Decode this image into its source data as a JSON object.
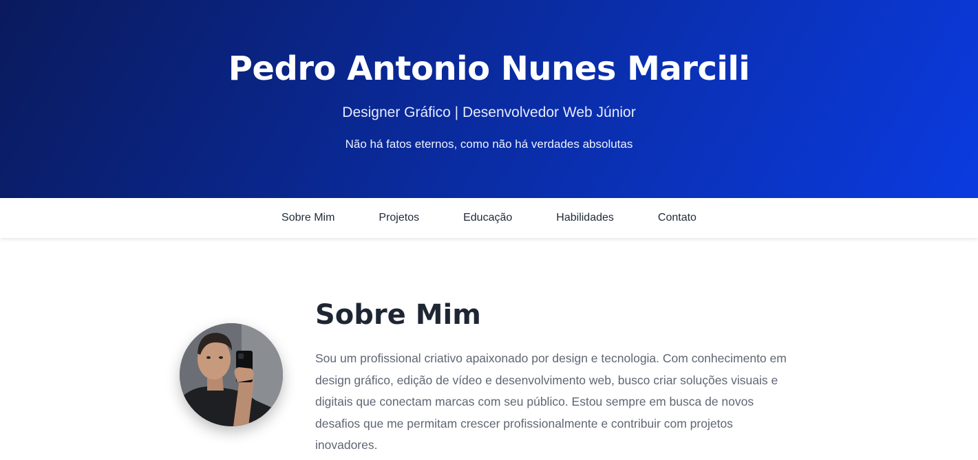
{
  "hero": {
    "name": "Pedro Antonio Nunes Marcili",
    "subtitle": "Designer Gráfico | Desenvolvedor Web Júnior",
    "quote": "Não há fatos eternos, como não há verdades absolutas"
  },
  "nav": {
    "items": [
      {
        "label": "Sobre Mim"
      },
      {
        "label": "Projetos"
      },
      {
        "label": "Educação"
      },
      {
        "label": "Habilidades"
      },
      {
        "label": "Contato"
      }
    ]
  },
  "about": {
    "title": "Sobre Mim",
    "text": "Sou um profissional criativo apaixonado por design e tecnologia. Com conhecimento em design gráfico, edição de vídeo e desenvolvimento web, busco criar soluções visuais e digitais que conectam marcas com seu público. Estou sempre em busca de novos desafios que me permitam crescer profissionalmente e contribuir com projetos inovadores."
  },
  "colors": {
    "hero_gradient_start": "#0a1a5c",
    "hero_gradient_end": "#0b3be0",
    "heading": "#1f2633",
    "body_text": "#5f6673"
  }
}
